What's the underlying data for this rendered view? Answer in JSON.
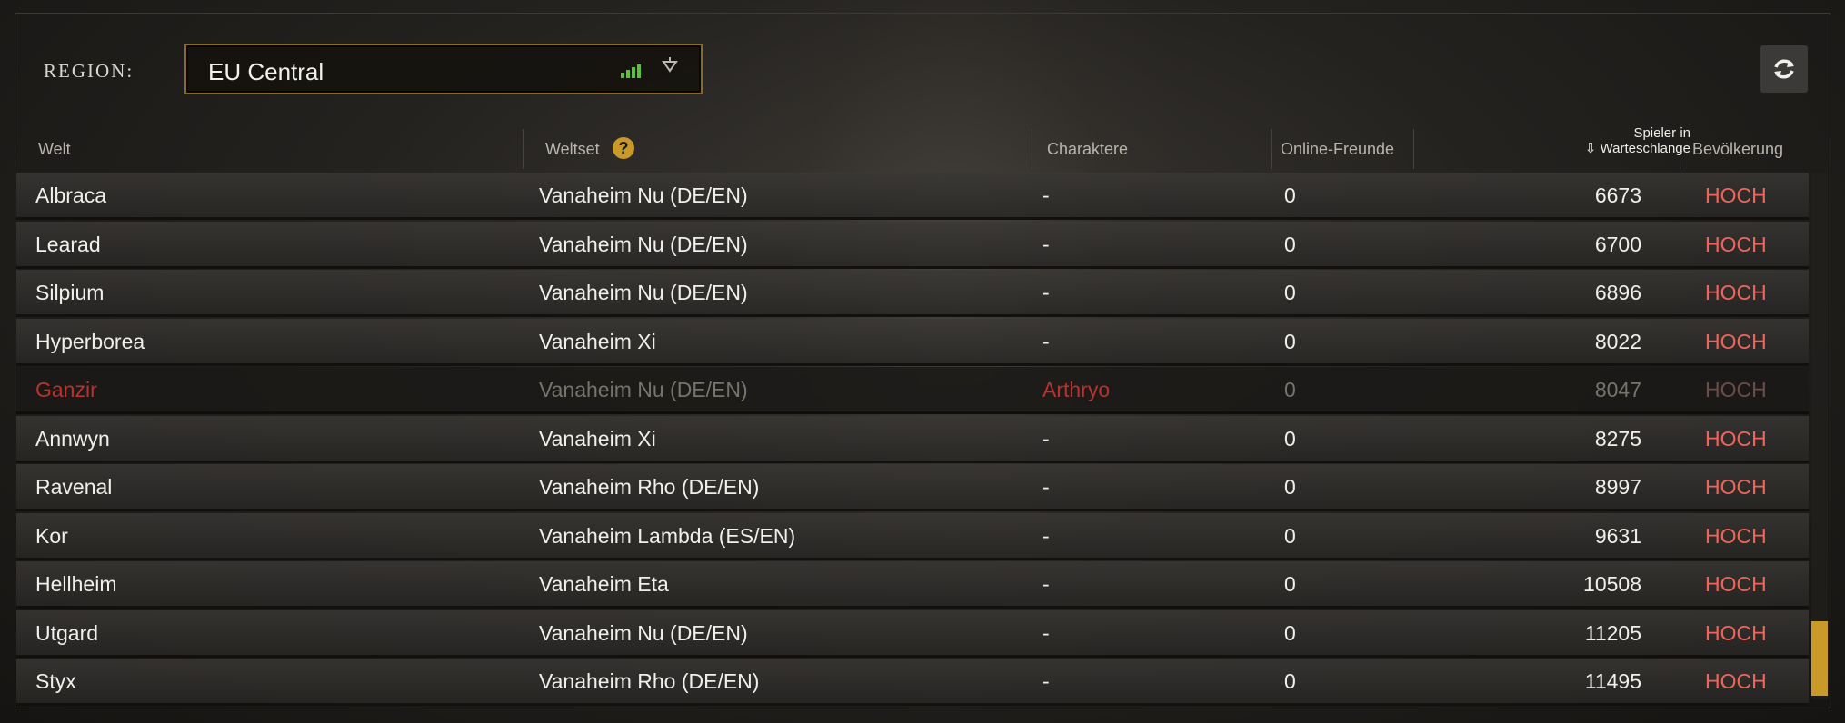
{
  "region": {
    "label": "REGION:",
    "selected": "EU Central",
    "signal_bars": 4
  },
  "refresh": {
    "icon": "refresh-icon"
  },
  "columns": {
    "world": "Welt",
    "worldset": "Weltset",
    "characters": "Charaktere",
    "online_friends": "Online-Freunde",
    "queue_line1": "Spieler in",
    "queue_line2": "Warteschlange",
    "queue_sort_icon": "sort-down-icon",
    "population": "Bevölkerung"
  },
  "rows": [
    {
      "world": "Albraca",
      "worldset": "Vanaheim Nu (DE/EN)",
      "characters": "-",
      "friends": "0",
      "queue": "6673",
      "population": "HOCH"
    },
    {
      "world": "Learad",
      "worldset": "Vanaheim Nu (DE/EN)",
      "characters": "-",
      "friends": "0",
      "queue": "6700",
      "population": "HOCH"
    },
    {
      "world": "Silpium",
      "worldset": "Vanaheim Nu (DE/EN)",
      "characters": "-",
      "friends": "0",
      "queue": "6896",
      "population": "HOCH"
    },
    {
      "world": "Hyperborea",
      "worldset": "Vanaheim Xi",
      "characters": "-",
      "friends": "0",
      "queue": "8022",
      "population": "HOCH"
    },
    {
      "world": "Ganzir",
      "worldset": "Vanaheim Nu (DE/EN)",
      "characters": "Arthryo",
      "friends": "0",
      "queue": "8047",
      "population": "HOCH"
    },
    {
      "world": "Annwyn",
      "worldset": "Vanaheim Xi",
      "characters": "-",
      "friends": "0",
      "queue": "8275",
      "population": "HOCH"
    },
    {
      "world": "Ravenal",
      "worldset": "Vanaheim Rho (DE/EN)",
      "characters": "-",
      "friends": "0",
      "queue": "8997",
      "population": "HOCH"
    },
    {
      "world": "Kor",
      "worldset": "Vanaheim Lambda (ES/EN)",
      "characters": "-",
      "friends": "0",
      "queue": "9631",
      "population": "HOCH"
    },
    {
      "world": "Hellheim",
      "worldset": "Vanaheim Eta",
      "characters": "-",
      "friends": "0",
      "queue": "10508",
      "population": "HOCH"
    },
    {
      "world": "Utgard",
      "worldset": "Vanaheim Nu (DE/EN)",
      "characters": "-",
      "friends": "0",
      "queue": "11205",
      "population": "HOCH"
    },
    {
      "world": "Styx",
      "worldset": "Vanaheim Rho (DE/EN)",
      "characters": "-",
      "friends": "0",
      "queue": "11495",
      "population": "HOCH"
    }
  ],
  "colors": {
    "population_high": "#f0655a",
    "accent_gold": "#c99a28",
    "signal_green": "#5cc23a"
  }
}
